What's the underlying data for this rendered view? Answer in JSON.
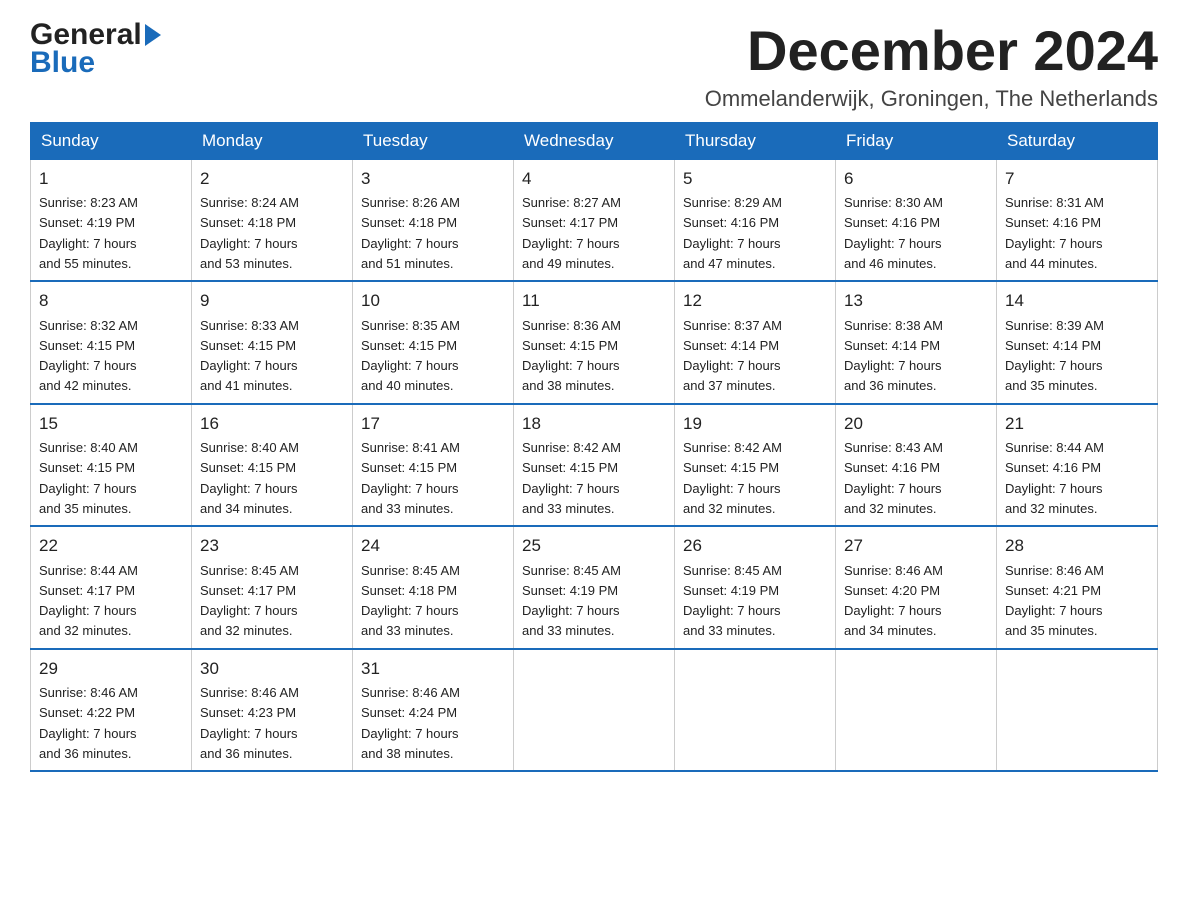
{
  "header": {
    "logo_text_black": "General",
    "logo_text_blue": "Blue",
    "month_title": "December 2024",
    "location": "Ommelanderwijk, Groningen, The Netherlands"
  },
  "calendar": {
    "days_of_week": [
      "Sunday",
      "Monday",
      "Tuesday",
      "Wednesday",
      "Thursday",
      "Friday",
      "Saturday"
    ],
    "weeks": [
      [
        {
          "day": "1",
          "sunrise": "8:23 AM",
          "sunset": "4:19 PM",
          "daylight": "7 hours and 55 minutes."
        },
        {
          "day": "2",
          "sunrise": "8:24 AM",
          "sunset": "4:18 PM",
          "daylight": "7 hours and 53 minutes."
        },
        {
          "day": "3",
          "sunrise": "8:26 AM",
          "sunset": "4:18 PM",
          "daylight": "7 hours and 51 minutes."
        },
        {
          "day": "4",
          "sunrise": "8:27 AM",
          "sunset": "4:17 PM",
          "daylight": "7 hours and 49 minutes."
        },
        {
          "day": "5",
          "sunrise": "8:29 AM",
          "sunset": "4:16 PM",
          "daylight": "7 hours and 47 minutes."
        },
        {
          "day": "6",
          "sunrise": "8:30 AM",
          "sunset": "4:16 PM",
          "daylight": "7 hours and 46 minutes."
        },
        {
          "day": "7",
          "sunrise": "8:31 AM",
          "sunset": "4:16 PM",
          "daylight": "7 hours and 44 minutes."
        }
      ],
      [
        {
          "day": "8",
          "sunrise": "8:32 AM",
          "sunset": "4:15 PM",
          "daylight": "7 hours and 42 minutes."
        },
        {
          "day": "9",
          "sunrise": "8:33 AM",
          "sunset": "4:15 PM",
          "daylight": "7 hours and 41 minutes."
        },
        {
          "day": "10",
          "sunrise": "8:35 AM",
          "sunset": "4:15 PM",
          "daylight": "7 hours and 40 minutes."
        },
        {
          "day": "11",
          "sunrise": "8:36 AM",
          "sunset": "4:15 PM",
          "daylight": "7 hours and 38 minutes."
        },
        {
          "day": "12",
          "sunrise": "8:37 AM",
          "sunset": "4:14 PM",
          "daylight": "7 hours and 37 minutes."
        },
        {
          "day": "13",
          "sunrise": "8:38 AM",
          "sunset": "4:14 PM",
          "daylight": "7 hours and 36 minutes."
        },
        {
          "day": "14",
          "sunrise": "8:39 AM",
          "sunset": "4:14 PM",
          "daylight": "7 hours and 35 minutes."
        }
      ],
      [
        {
          "day": "15",
          "sunrise": "8:40 AM",
          "sunset": "4:15 PM",
          "daylight": "7 hours and 35 minutes."
        },
        {
          "day": "16",
          "sunrise": "8:40 AM",
          "sunset": "4:15 PM",
          "daylight": "7 hours and 34 minutes."
        },
        {
          "day": "17",
          "sunrise": "8:41 AM",
          "sunset": "4:15 PM",
          "daylight": "7 hours and 33 minutes."
        },
        {
          "day": "18",
          "sunrise": "8:42 AM",
          "sunset": "4:15 PM",
          "daylight": "7 hours and 33 minutes."
        },
        {
          "day": "19",
          "sunrise": "8:42 AM",
          "sunset": "4:15 PM",
          "daylight": "7 hours and 32 minutes."
        },
        {
          "day": "20",
          "sunrise": "8:43 AM",
          "sunset": "4:16 PM",
          "daylight": "7 hours and 32 minutes."
        },
        {
          "day": "21",
          "sunrise": "8:44 AM",
          "sunset": "4:16 PM",
          "daylight": "7 hours and 32 minutes."
        }
      ],
      [
        {
          "day": "22",
          "sunrise": "8:44 AM",
          "sunset": "4:17 PM",
          "daylight": "7 hours and 32 minutes."
        },
        {
          "day": "23",
          "sunrise": "8:45 AM",
          "sunset": "4:17 PM",
          "daylight": "7 hours and 32 minutes."
        },
        {
          "day": "24",
          "sunrise": "8:45 AM",
          "sunset": "4:18 PM",
          "daylight": "7 hours and 33 minutes."
        },
        {
          "day": "25",
          "sunrise": "8:45 AM",
          "sunset": "4:19 PM",
          "daylight": "7 hours and 33 minutes."
        },
        {
          "day": "26",
          "sunrise": "8:45 AM",
          "sunset": "4:19 PM",
          "daylight": "7 hours and 33 minutes."
        },
        {
          "day": "27",
          "sunrise": "8:46 AM",
          "sunset": "4:20 PM",
          "daylight": "7 hours and 34 minutes."
        },
        {
          "day": "28",
          "sunrise": "8:46 AM",
          "sunset": "4:21 PM",
          "daylight": "7 hours and 35 minutes."
        }
      ],
      [
        {
          "day": "29",
          "sunrise": "8:46 AM",
          "sunset": "4:22 PM",
          "daylight": "7 hours and 36 minutes."
        },
        {
          "day": "30",
          "sunrise": "8:46 AM",
          "sunset": "4:23 PM",
          "daylight": "7 hours and 36 minutes."
        },
        {
          "day": "31",
          "sunrise": "8:46 AM",
          "sunset": "4:24 PM",
          "daylight": "7 hours and 38 minutes."
        },
        null,
        null,
        null,
        null
      ]
    ],
    "labels": {
      "sunrise": "Sunrise:",
      "sunset": "Sunset:",
      "daylight": "Daylight:"
    }
  }
}
